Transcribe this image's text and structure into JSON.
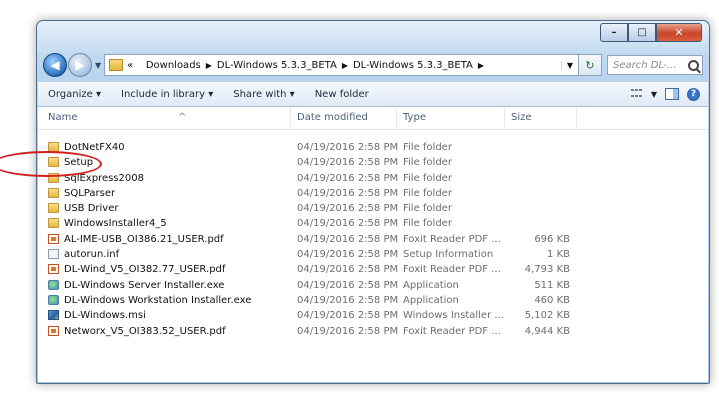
{
  "window": {
    "caption_minimize": "–",
    "caption_maximize": "□",
    "caption_close": "✕"
  },
  "address_bar": {
    "prefix": "«",
    "crumbs": [
      "Downloads",
      "DL-Windows 5.3.3_BETA",
      "DL-Windows 5.3.3_BETA"
    ],
    "search_placeholder": "Search DL-..."
  },
  "toolbar": {
    "organize": "Organize ▾",
    "include": "Include in library ▾",
    "share": "Share with ▾",
    "new_folder": "New folder"
  },
  "columns": {
    "name": "Name",
    "date": "Date modified",
    "type": "Type",
    "size": "Size"
  },
  "files": [
    {
      "name": "DotNetFX40",
      "date": "04/19/2016 2:58 PM",
      "type": "File folder",
      "size": "",
      "icon": "folder-icon"
    },
    {
      "name": "Setup",
      "date": "04/19/2016 2:58 PM",
      "type": "File folder",
      "size": "",
      "icon": "folder-icon"
    },
    {
      "name": "SqlExpress2008",
      "date": "04/19/2016 2:58 PM",
      "type": "File folder",
      "size": "",
      "icon": "folder-icon"
    },
    {
      "name": "SQLParser",
      "date": "04/19/2016 2:58 PM",
      "type": "File folder",
      "size": "",
      "icon": "folder-icon"
    },
    {
      "name": "USB Driver",
      "date": "04/19/2016 2:58 PM",
      "type": "File folder",
      "size": "",
      "icon": "folder-icon"
    },
    {
      "name": "WindowsInstaller4_5",
      "date": "04/19/2016 2:58 PM",
      "type": "File folder",
      "size": "",
      "icon": "folder-icon"
    },
    {
      "name": "AL-IME-USB_OI386.21_USER.pdf",
      "date": "04/19/2016 2:58 PM",
      "type": "Foxit Reader PDF ...",
      "size": "696 KB",
      "icon": "pdf-icon"
    },
    {
      "name": "autorun.inf",
      "date": "04/19/2016 2:58 PM",
      "type": "Setup Information",
      "size": "1 KB",
      "icon": "inf-icon"
    },
    {
      "name": "DL-Wind_V5_OI382.77_USER.pdf",
      "date": "04/19/2016 2:58 PM",
      "type": "Foxit Reader PDF ...",
      "size": "4,793 KB",
      "icon": "pdf-icon"
    },
    {
      "name": "DL-Windows Server Installer.exe",
      "date": "04/19/2016 2:58 PM",
      "type": "Application",
      "size": "511 KB",
      "icon": "exe-icon"
    },
    {
      "name": "DL-Windows Workstation Installer.exe",
      "date": "04/19/2016 2:58 PM",
      "type": "Application",
      "size": "460 KB",
      "icon": "exe-icon"
    },
    {
      "name": "DL-Windows.msi",
      "date": "04/19/2016 2:58 PM",
      "type": "Windows Installer ...",
      "size": "5,102 KB",
      "icon": "msi-icon"
    },
    {
      "name": "Networx_V5_OI383.52_USER.pdf",
      "date": "04/19/2016 2:58 PM",
      "type": "Foxit Reader PDF ...",
      "size": "4,944 KB",
      "icon": "pdf-icon"
    }
  ]
}
